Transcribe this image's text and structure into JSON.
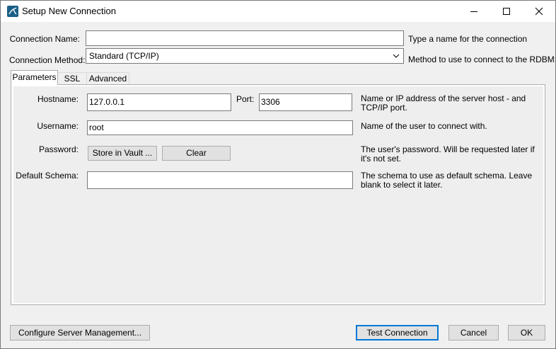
{
  "window": {
    "title": "Setup New Connection"
  },
  "connection_name": {
    "label": "Connection Name:",
    "value": "",
    "help": "Type a name for the connection"
  },
  "connection_method": {
    "label": "Connection Method:",
    "selected": "Standard (TCP/IP)",
    "help": "Method to use to connect to the RDBMS"
  },
  "tabs": [
    {
      "label": "Parameters",
      "active": true
    },
    {
      "label": "SSL",
      "active": false
    },
    {
      "label": "Advanced",
      "active": false
    }
  ],
  "parameters": {
    "hostname": {
      "label": "Hostname:",
      "value": "127.0.0.1",
      "help": "Name or IP address of the server host - and TCP/IP port."
    },
    "port": {
      "label": "Port:",
      "value": "3306"
    },
    "username": {
      "label": "Username:",
      "value": "root",
      "help": "Name of the user to connect with."
    },
    "password": {
      "label": "Password:",
      "store_button": "Store in Vault ...",
      "clear_button": "Clear",
      "help": "The user's password. Will be requested later if it's not set."
    },
    "default_schema": {
      "label": "Default Schema:",
      "value": "",
      "help": "The schema to use as default schema. Leave blank to select it later."
    }
  },
  "footer": {
    "configure_button": "Configure Server Management...",
    "test_button": "Test Connection",
    "cancel_button": "Cancel",
    "ok_button": "OK"
  }
}
